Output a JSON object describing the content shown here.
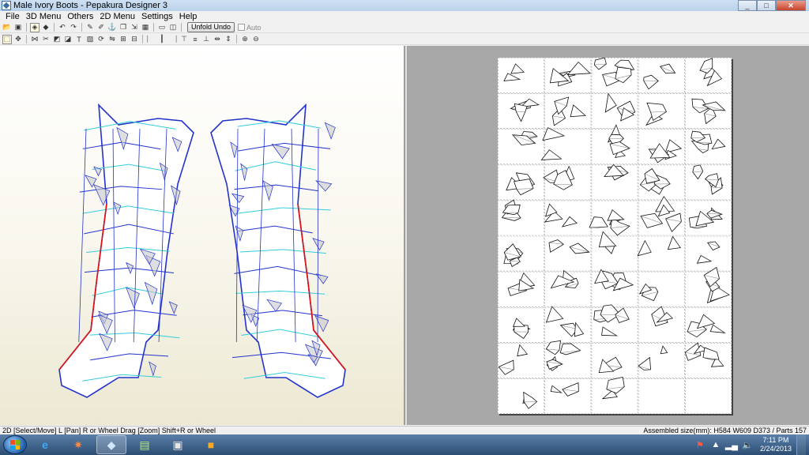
{
  "window": {
    "title": "Male Ivory Boots - Pepakura Designer 3",
    "controls": [
      "minimize-icon",
      "maximize-icon",
      "close-icon"
    ]
  },
  "menu": [
    "File",
    "3D Menu",
    "Others",
    "2D Menu",
    "Settings",
    "Help"
  ],
  "toolbar": {
    "unfold_undo_label": "Unfold Undo",
    "auto_label": "Auto",
    "auto_checked": false,
    "row1_icons": [
      "open-icon",
      "save-icon",
      "view3d-toggle-icon",
      "view-cube-icon",
      "rotate-left-icon",
      "rotate-right-icon",
      "pencil-icon",
      "edit-icon",
      "anchor-icon",
      "copy-icon",
      "scale-icon",
      "layout-icon",
      "single-view-icon",
      "split-view-icon"
    ],
    "row2_icons": [
      "select-icon",
      "pan-icon",
      "join-icon",
      "split-icon",
      "flap-icon",
      "flap-toggle-icon",
      "text-icon",
      "image-icon",
      "rotate-part-icon",
      "mirror-icon",
      "grid-icon",
      "dimension-icon",
      "align-left-icon",
      "align-center-icon",
      "align-right-icon",
      "align-top-icon",
      "align-middle-icon",
      "align-bottom-icon",
      "distribute-h-icon",
      "distribute-v-icon",
      "zoom-in-icon",
      "zoom-out-icon"
    ]
  },
  "view2d": {
    "paper_columns": 5,
    "paper_rows": 10,
    "filled_cells": 48
  },
  "status": {
    "left": "2D [Select/Move] L [Pan] R or Wheel Drag [Zoom] Shift+R or Wheel",
    "right": "Assembled size(mm): H584 W609 D373 / Parts 157"
  },
  "taskbar": {
    "apps": [
      "start-button",
      "ie-icon",
      "media-icon",
      "pepakura-icon",
      "notepad-icon",
      "game-icon",
      "paint-icon"
    ],
    "time": "7:11 PM",
    "date": "2/24/2013"
  },
  "colors": {
    "mesh_edge": "#2233cc",
    "fold_line": "#33ccdd",
    "cut_line": "#dd1111",
    "face_shade": "#c8c8cc",
    "view2d_bg": "#a8a8a8"
  }
}
